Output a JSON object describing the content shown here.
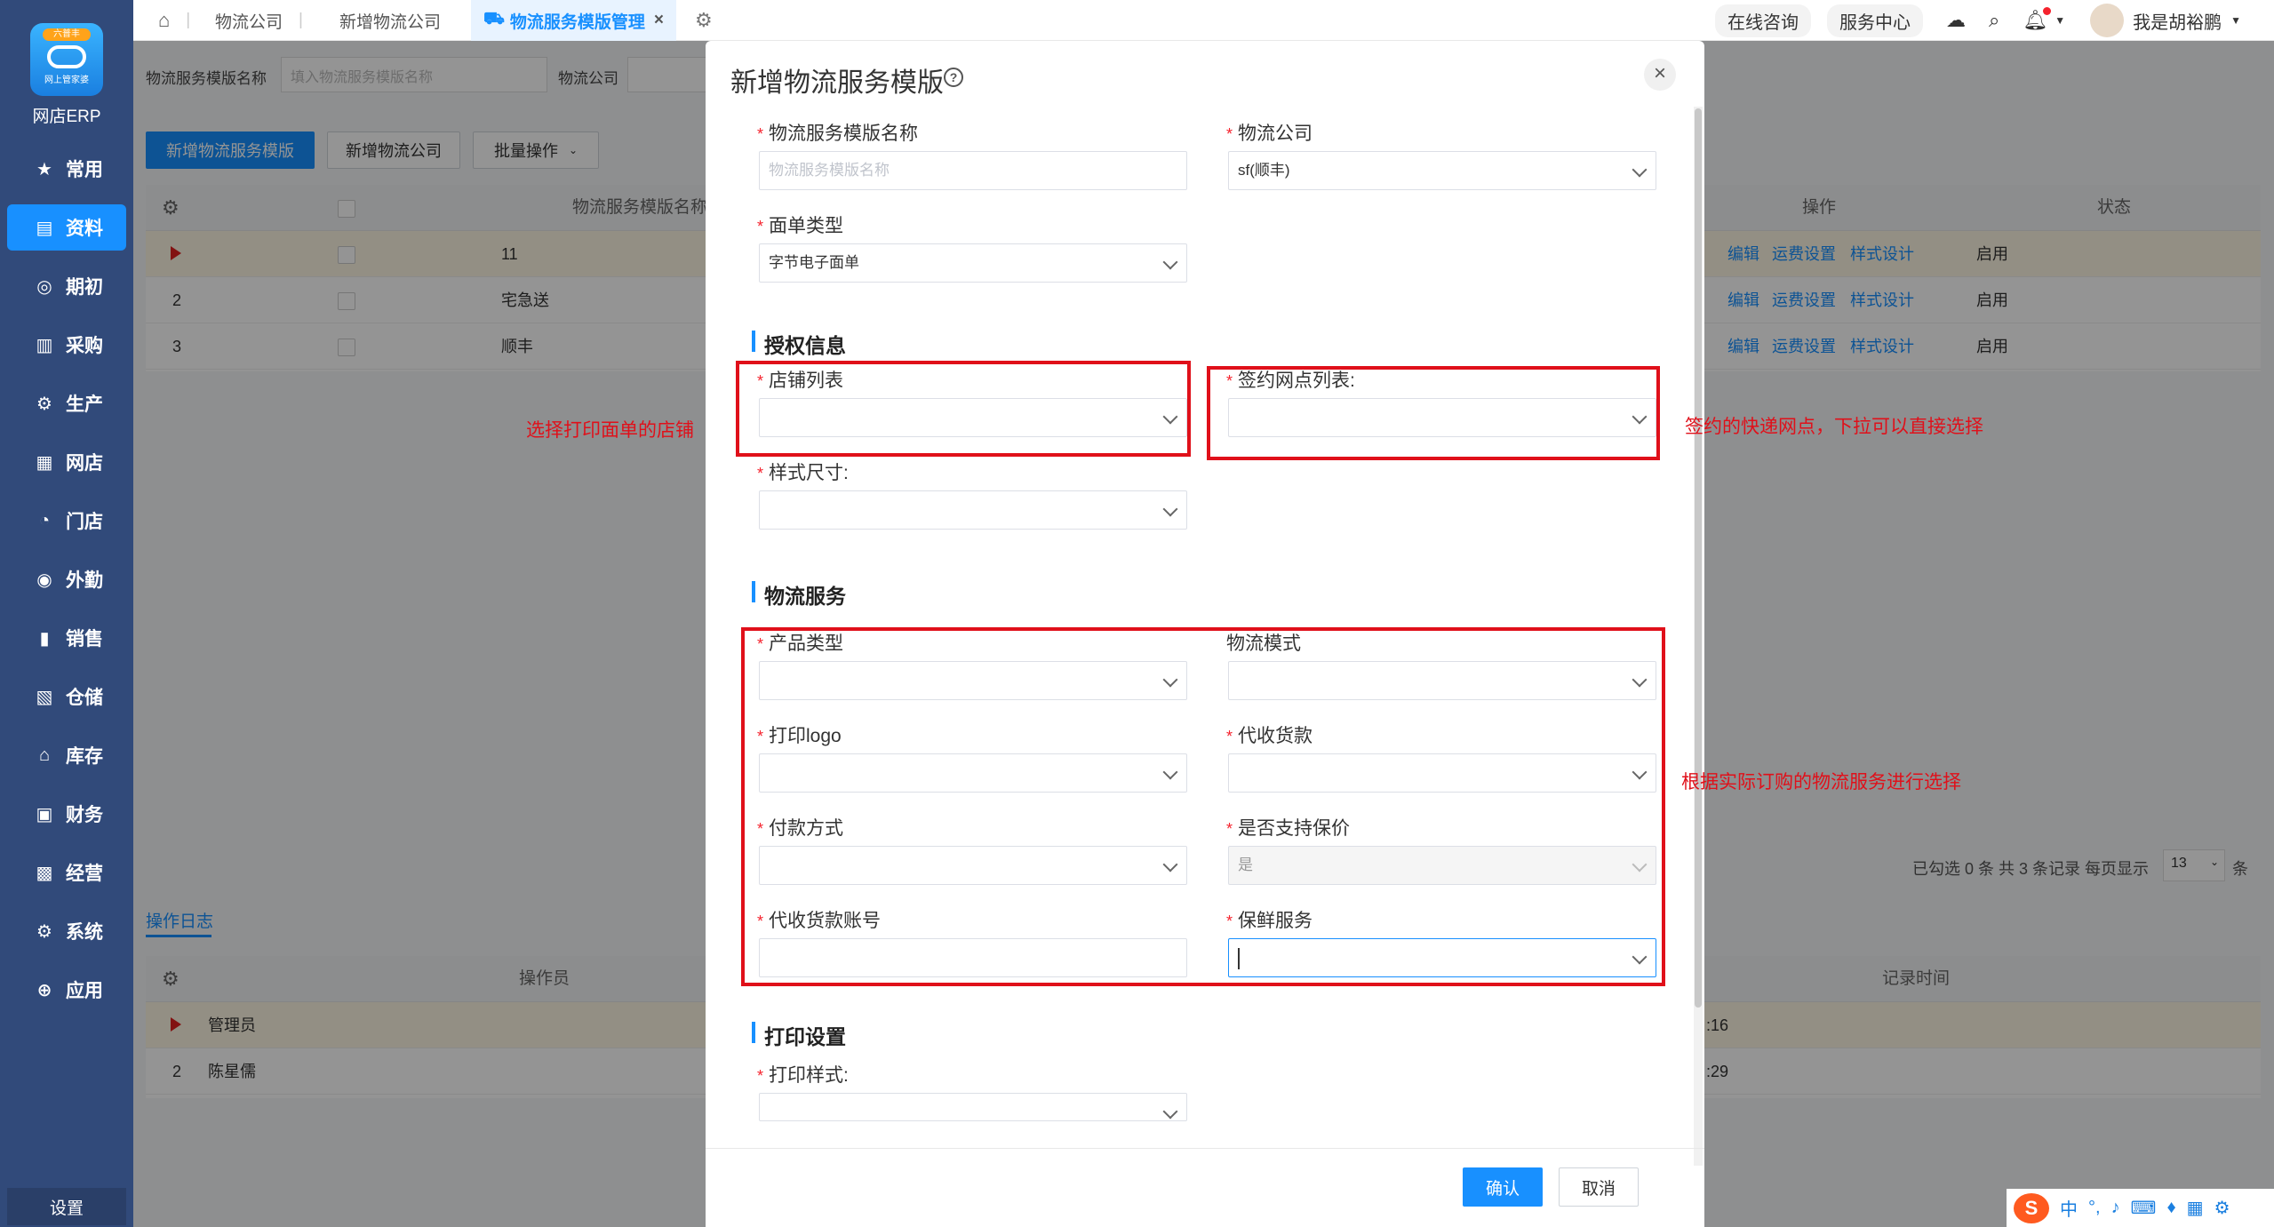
{
  "app": {
    "badge": "六普丰",
    "logo_sub": "网上管家婆",
    "name": "网店ERP"
  },
  "sidebar": {
    "items": [
      {
        "label": "常用",
        "icon": "star-icon",
        "glyph": "★"
      },
      {
        "label": "资料",
        "icon": "document-icon",
        "glyph": "▤"
      },
      {
        "label": "期初",
        "icon": "target-icon",
        "glyph": "◎"
      },
      {
        "label": "采购",
        "icon": "purchase-icon",
        "glyph": "▥"
      },
      {
        "label": "生产",
        "icon": "production-icon",
        "glyph": "⚙"
      },
      {
        "label": "网店",
        "icon": "store-icon",
        "glyph": "▦"
      },
      {
        "label": "门店",
        "icon": "pie-icon",
        "glyph": "◔"
      },
      {
        "label": "外勤",
        "icon": "field-icon",
        "glyph": "◉"
      },
      {
        "label": "销售",
        "icon": "sales-icon",
        "glyph": "▮"
      },
      {
        "label": "仓储",
        "icon": "warehouse-icon",
        "glyph": "▧"
      },
      {
        "label": "库存",
        "icon": "inventory-icon",
        "glyph": "⌂"
      },
      {
        "label": "财务",
        "icon": "finance-icon",
        "glyph": "▣"
      },
      {
        "label": "经营",
        "icon": "business-icon",
        "glyph": "▩"
      },
      {
        "label": "系统",
        "icon": "system-icon",
        "glyph": "⚙"
      },
      {
        "label": "应用",
        "icon": "apps-icon",
        "glyph": "⊕"
      }
    ],
    "settings": "设置"
  },
  "topbar": {
    "tabs": [
      "物流公司",
      "新增物流公司",
      "物流服务模版管理"
    ],
    "online_consult": "在线咨询",
    "service_center": "服务中心",
    "user_name": "我是胡裕鹏"
  },
  "bg": {
    "filter_name_label": "物流服务模版名称",
    "filter_name_placeholder": "填入物流服务模版名称",
    "filter_company_label": "物流公司",
    "btn_add_template": "新增物流服务模版",
    "btn_add_company": "新增物流公司",
    "btn_batch": "批量操作",
    "table_headers": {
      "name": "物流服务模版名称",
      "op": "操作",
      "status": "状态"
    },
    "rows": [
      {
        "no": "",
        "name": "11",
        "op1": "编辑",
        "op2": "运费设置",
        "op3": "样式设计",
        "status": "启用"
      },
      {
        "no": "2",
        "name": "宅急送",
        "op1": "编辑",
        "op2": "运费设置",
        "op3": "样式设计",
        "status": "启用"
      },
      {
        "no": "3",
        "name": "顺丰",
        "op1": "编辑",
        "op2": "运费设置",
        "op3": "样式设计",
        "status": "启用"
      }
    ],
    "pager": "已勾选 0 条  共 3 条记录  每页显示",
    "page_size": "13",
    "page_unit": "条",
    "log_tab": "操作日志",
    "log_headers": {
      "operator": "操作员",
      "time": "记录时间"
    },
    "log_rows": [
      {
        "no": "",
        "operator": "管理员",
        "time": ":16"
      },
      {
        "no": "2",
        "operator": "陈星儒",
        "time": ":29"
      }
    ]
  },
  "modal": {
    "title": "新增物流服务模版",
    "help": "?",
    "close": "×",
    "fields": {
      "template_name": {
        "label": "物流服务模版名称",
        "placeholder": "物流服务模版名称"
      },
      "company": {
        "label": "物流公司",
        "value": "sf(顺丰)"
      },
      "waybill_type": {
        "label": "面单类型",
        "value": "字节电子面单"
      },
      "shop_list": {
        "label": "店铺列表"
      },
      "branch_list": {
        "label": "签约网点列表:"
      },
      "style_size": {
        "label": "样式尺寸:"
      },
      "product_type": {
        "label": "产品类型"
      },
      "logistics_mode": {
        "label": "物流模式"
      },
      "print_logo": {
        "label": "打印logo"
      },
      "cod": {
        "label": "代收货款"
      },
      "payment": {
        "label": "付款方式"
      },
      "insurance": {
        "label": "是否支持保价",
        "value": "是"
      },
      "cod_account": {
        "label": "代收货款账号"
      },
      "fresh_service": {
        "label": "保鲜服务"
      },
      "print_style": {
        "label": "打印样式:"
      }
    },
    "sections": {
      "auth": "授权信息",
      "logistics": "物流服务",
      "print": "打印设置"
    },
    "confirm": "确认",
    "cancel": "取消"
  },
  "annotations": {
    "shop_note": "选择打印面单的店铺",
    "branch_note": "签约的快递网点，下拉可以直接选择",
    "service_note": "根据实际订购的物流服务进行选择"
  },
  "colors": {
    "primary": "#1890ff",
    "sidebar": "#314a7a",
    "annotation": "#e0101a",
    "required": "#f5222d"
  }
}
